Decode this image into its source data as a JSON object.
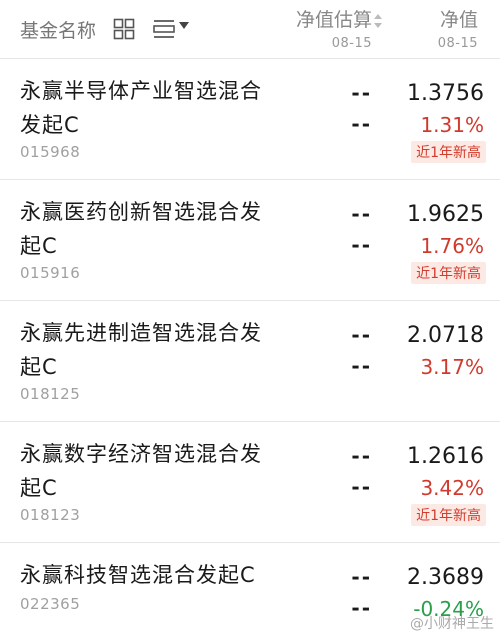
{
  "header": {
    "name_label": "基金名称",
    "est_label": "净值估算",
    "est_date": "08-15",
    "nav_label": "净值",
    "nav_date": "08-15"
  },
  "funds": [
    {
      "name": "永赢半导体产业智选混合发起C",
      "code": "015968",
      "est1": "--",
      "est2": "--",
      "nav": "1.3756",
      "change": "1.31%",
      "badge": "近1年新高"
    },
    {
      "name": "永赢医药创新智选混合发起C",
      "code": "015916",
      "est1": "--",
      "est2": "--",
      "nav": "1.9625",
      "change": "1.76%",
      "badge": "近1年新高"
    },
    {
      "name": "永赢先进制造智选混合发起C",
      "code": "018125",
      "est1": "--",
      "est2": "--",
      "nav": "2.0718",
      "change": "3.17%",
      "badge": ""
    },
    {
      "name": "永赢数字经济智选混合发起C",
      "code": "018123",
      "est1": "--",
      "est2": "--",
      "nav": "1.2616",
      "change": "3.42%",
      "badge": "近1年新高"
    },
    {
      "name": "永赢科技智选混合发起C",
      "code": "022365",
      "est1": "--",
      "est2": "--",
      "nav": "2.3689",
      "change": "-0.24%",
      "badge": ""
    }
  ],
  "watermark": "@小财神王生",
  "colors": {
    "up": "#d03a2d",
    "down": "#2a9e4a",
    "badge_bg": "#fde9e3"
  },
  "icons": [
    "grid-view-icon",
    "list-view-icon",
    "dropdown-icon",
    "sort-arrows-icon"
  ]
}
